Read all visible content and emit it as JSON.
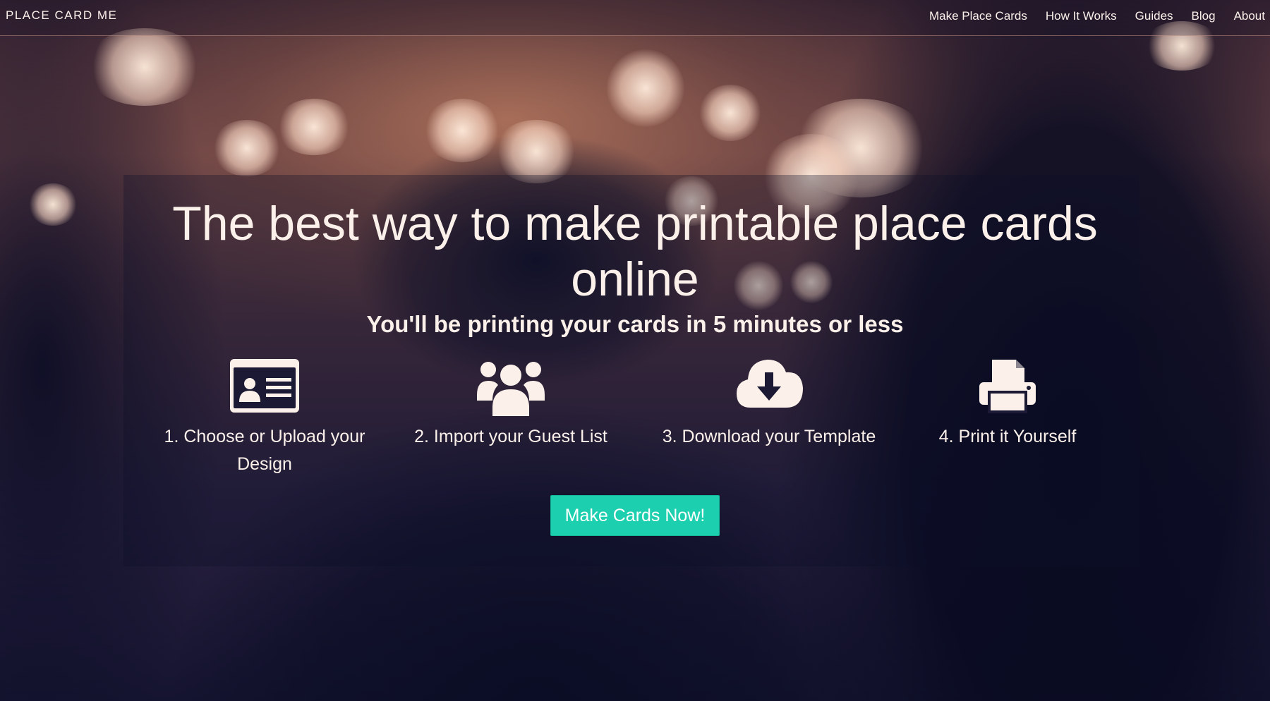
{
  "brand": "PLACE CARD ME",
  "nav": {
    "items": [
      {
        "label": "Make Place Cards"
      },
      {
        "label": "How It Works"
      },
      {
        "label": "Guides"
      },
      {
        "label": "Blog"
      },
      {
        "label": "About"
      }
    ]
  },
  "hero": {
    "title": "The best way to make printable place cards online",
    "subtitle": "You'll be printing your cards in 5 minutes or less"
  },
  "steps": [
    {
      "label": "1. Choose or Upload your Design",
      "icon": "id-card-icon"
    },
    {
      "label": "2. Import your Guest List",
      "icon": "users-icon"
    },
    {
      "label": "3. Download your Template",
      "icon": "cloud-download-icon"
    },
    {
      "label": "4. Print it Yourself",
      "icon": "printer-icon"
    }
  ],
  "cta": {
    "label": "Make Cards Now!"
  },
  "colors": {
    "accent": "#1ccfae",
    "text": "#fbf1ea",
    "background_dark": "#151430",
    "background_warm": "#6b4448"
  }
}
